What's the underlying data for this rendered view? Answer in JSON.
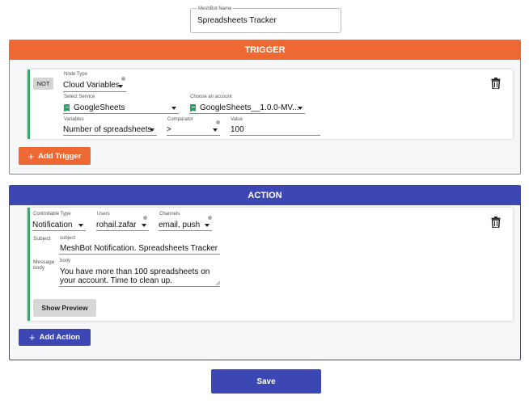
{
  "meshbot": {
    "name_label": "MeshBot Name",
    "name_value": "Spreadsheets Tracker"
  },
  "trigger": {
    "header": "TRIGGER",
    "not_label": "NOT",
    "node_type_label": "Node Type",
    "node_type_value": "Cloud Variables",
    "service_label": "Select Service",
    "service_value": "GoogleSheets",
    "account_label": "Choose an account",
    "account_value": "GoogleSheets__1.0.0-MV...",
    "variables_label": "Variables",
    "variables_value": "Number of spreadsheets",
    "comparator_label": "Comparator",
    "comparator_value": ">",
    "value_label": "Value",
    "value_value": "100",
    "add_label": "Add Trigger"
  },
  "action": {
    "header": "ACTION",
    "controllable_label": "Controllable Type",
    "controllable_value": "Notification",
    "users_label": "Users",
    "users_value": "rohail.zafar",
    "channels_label": "Channels",
    "channels_value": "email, push",
    "subject_side_label": "Subject",
    "subject_label": "subject",
    "subject_value": "MeshBot Notification. Spreadsheets Tracker",
    "body_side_label": "Message body",
    "body_label": "body",
    "body_value": "You have more than 100 spreadsheets on your account. Time to clean up.",
    "preview_label": "Show Preview",
    "add_label": "Add Action"
  },
  "save_label": "Save",
  "icons": {
    "delete": "trash-icon",
    "sheets": "google-sheets-icon",
    "dropdown": "caret-down-icon",
    "info": "info-icon",
    "add": "plus-icon"
  },
  "colors": {
    "trigger_accent": "#ee6833",
    "action_accent": "#3d47b4",
    "active_stripe": "#3ca66b"
  }
}
